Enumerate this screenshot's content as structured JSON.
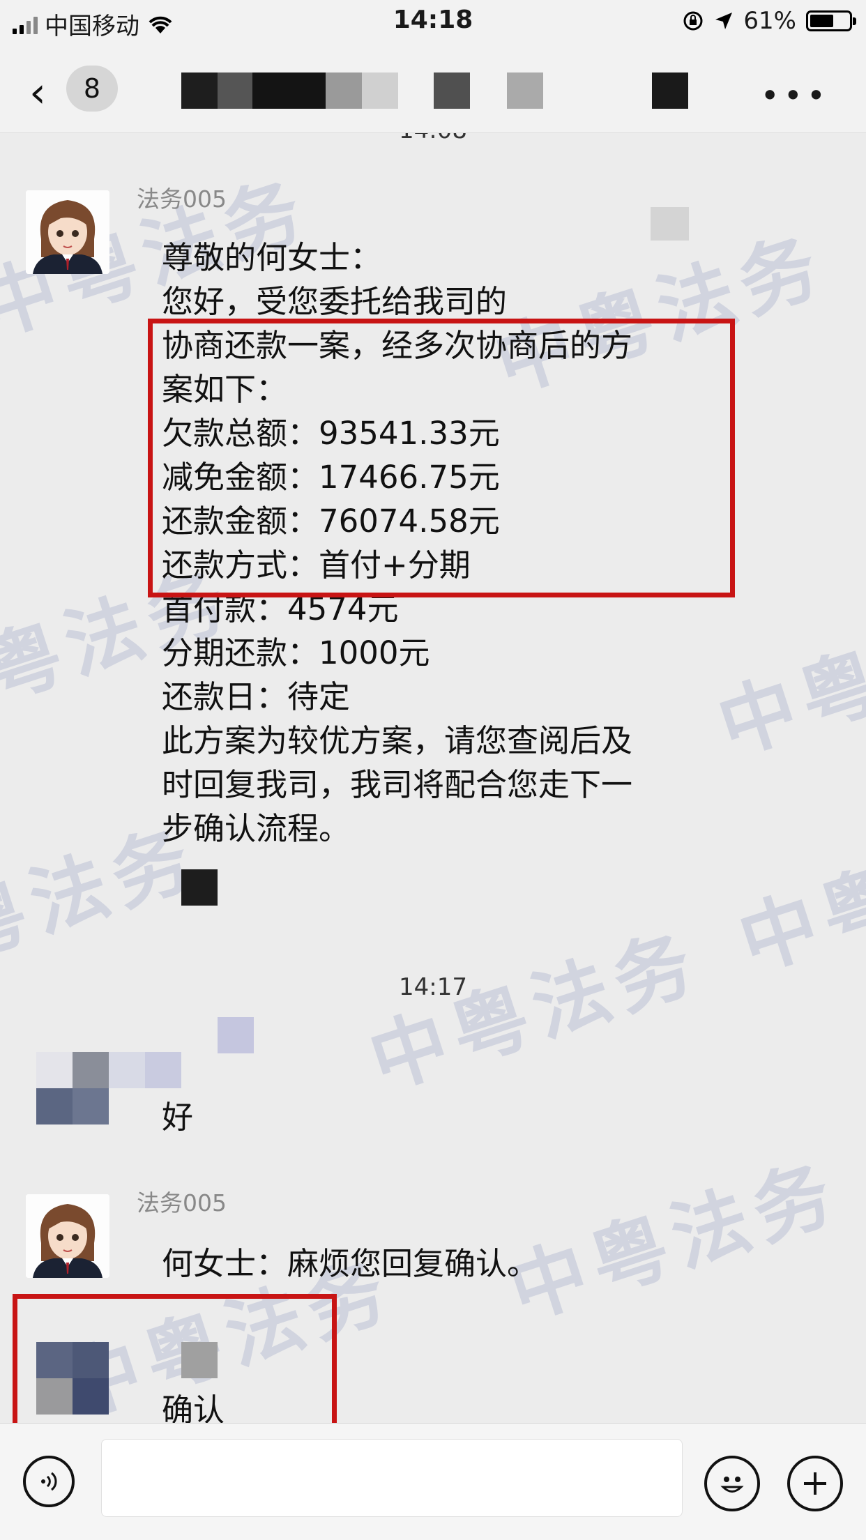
{
  "status_bar": {
    "carrier": "中国移动",
    "time": "14:18",
    "battery": "61%",
    "battery_level": 0.61
  },
  "nav": {
    "back_icon": "chevron-left-icon",
    "unread_count": "8",
    "more_icon": "ellipsis-icon"
  },
  "chat": {
    "watermark": "中粤法务",
    "timestamp_top_partial": "14:08",
    "message1": {
      "sender": "法务005",
      "lines": [
        "尊敬的何女士：",
        "您好，受您委托给我司的",
        "协商还款一案，经多次协商后的方",
        "案如下：",
        "欠款总额：93541.33元",
        "减免金额：17466.75元",
        "还款金额：76074.58元",
        "还款方式：首付+分期",
        "首付款：4574元",
        "分期还款：1000元",
        "还款日：待定",
        "此方案为较优方案，请您查阅后及",
        "时回复我司，我司将配合您走下一",
        "步确认流程。"
      ]
    },
    "timestamp_mid": "14:17",
    "message2": {
      "text": "好"
    },
    "message3": {
      "sender": "法务005",
      "text": "何女士：麻烦您回复确认。"
    },
    "message4": {
      "text": "确认"
    }
  },
  "input_bar": {
    "voice_icon": "voice-icon",
    "emoji_icon": "emoji-icon",
    "plus_icon": "plus-icon"
  },
  "colors": {
    "highlight_box": "#c81414",
    "chat_bg": "#ececec",
    "bar_bg": "#f2f2f2"
  }
}
